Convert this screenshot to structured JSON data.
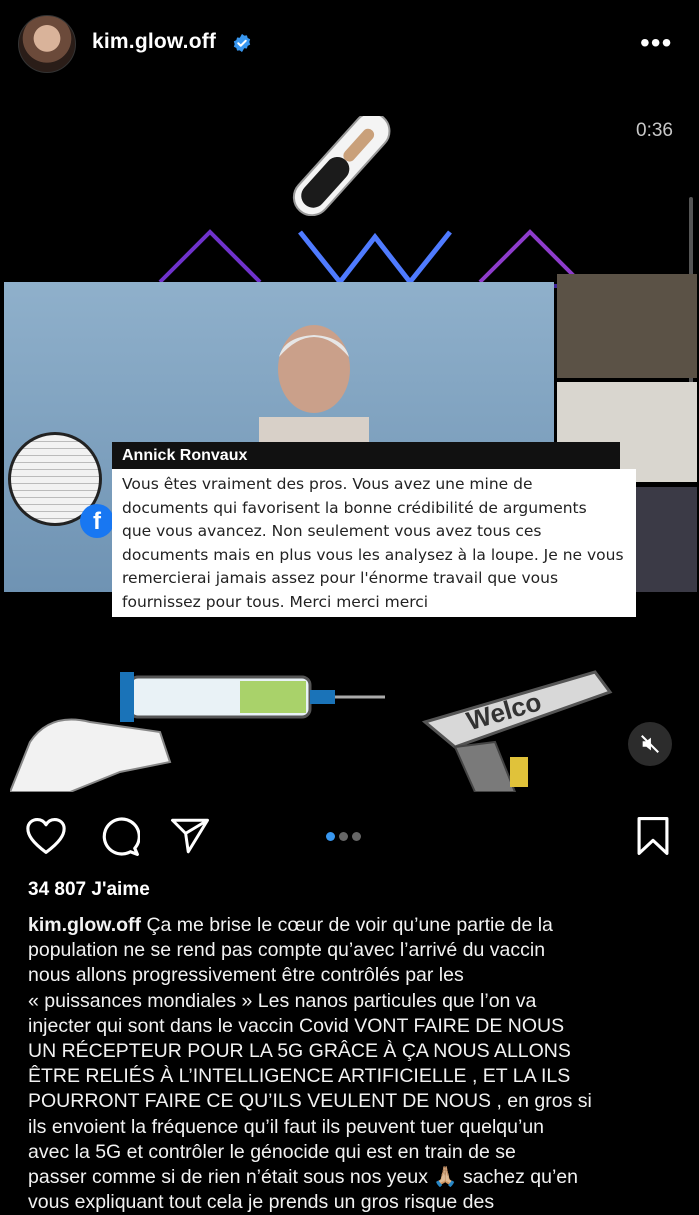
{
  "post": {
    "username": "kim.glow.off",
    "more_label": "•••",
    "video_time": "0:36",
    "likes_text": "34 807 J'aime",
    "caption_user": "kim.glow.off",
    "caption_lines": [
      "Ça me brise le cœur de voir qu’une partie de la",
      "population ne se rend pas compte qu’avec l’arrivé du vaccin",
      "nous allons progressivement être contrôlés par les",
      "« puissances mondiales »  Les nanos particules que l’on va",
      "injecter qui sont dans le vaccin Covid VONT FAIRE DE NOUS",
      "UN RÉCEPTEUR POUR LA 5G GRÂCE À ÇA NOUS ALLONS",
      "ÊTRE RELIÉS À L’INTELLIGENCE ARTIFICIELLE , ET LA ILS",
      "POURRONT FAIRE CE QU’ILS VEULENT DE NOUS , en gros si",
      "ils envoient la fréquence qu’il faut ils peuvent tuer quelqu’un",
      "avec la 5G  et contrôler le génocide qui est en train de se",
      "passer comme si de rien n’était sous nos yeux 🙏🏼  sachez qu’en",
      "vous expliquant tout cela je prends un gros risque des"
    ]
  },
  "video": {
    "commenter_name": "Annick Ronvaux",
    "comment_lines": [
      "Vous êtes vraiment des pros. Vous avez une mine de",
      "documents qui favorisent la bonne crédibilité de arguments",
      "que vous avancez. Non seulement vous avez tous ces",
      "documents mais en plus vous les analysez à la loupe. Je ne vous",
      "remercierai jamais assez pour l'énorme travail que vous",
      "fournissez pour tous. Merci merci merci"
    ],
    "facebook_glyph": "f",
    "scanner_text": "Welco"
  },
  "carousel": {
    "count": 3,
    "active_index": 0
  },
  "colors": {
    "accent": "#3897f0",
    "verified": "#3897f0",
    "background": "#000000"
  },
  "icons": [
    "verified-icon",
    "more-icon",
    "heart-icon",
    "comment-icon",
    "share-icon",
    "bookmark-icon",
    "mute-icon"
  ]
}
